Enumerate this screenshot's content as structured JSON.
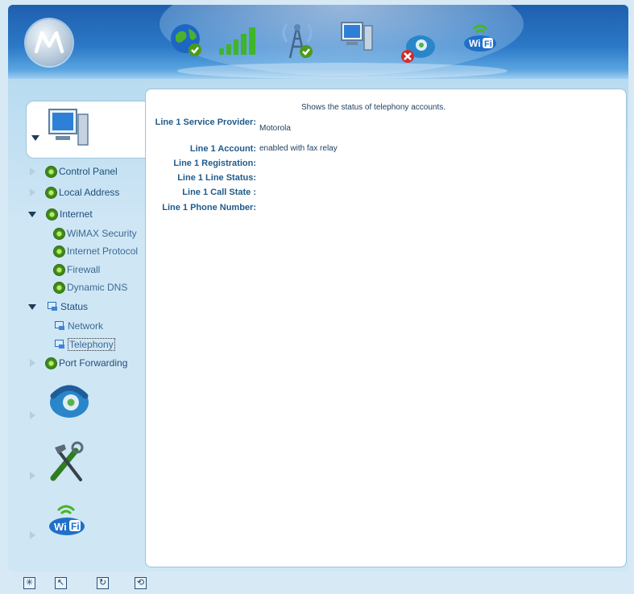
{
  "header": {
    "icons": [
      "motorola-logo",
      "globe-check-icon",
      "signal-bars-icon",
      "tower-check-icon",
      "computer-icon",
      "phone-error-icon",
      "wifi-icon"
    ]
  },
  "nav": {
    "items": [
      {
        "label": "Control Panel"
      },
      {
        "label": "Local Address"
      },
      {
        "label": "Internet"
      },
      {
        "label": "WiMAX Security"
      },
      {
        "label": "Internet Protocol"
      },
      {
        "label": "Firewall"
      },
      {
        "label": "Dynamic DNS"
      },
      {
        "label": "Status"
      },
      {
        "label": "Network"
      },
      {
        "label": "Telephony"
      },
      {
        "label": "Port Forwarding"
      }
    ]
  },
  "content": {
    "description": "Shows the status of telephony accounts.",
    "rows": [
      {
        "label": "Line 1 Service Provider:",
        "value": "Motorola"
      },
      {
        "label": "Line 1 Account:",
        "value": "enabled with fax relay"
      },
      {
        "label": "Line 1 Registration:",
        "value": ""
      },
      {
        "label": "Line 1 Line Status:",
        "value": ""
      },
      {
        "label": "Line 1 Call State :",
        "value": ""
      },
      {
        "label": "Line 1 Phone Number:",
        "value": ""
      }
    ]
  },
  "colors": {
    "header_blue": "#2c79c7",
    "panel_bg": "#cfe6f5",
    "label_blue": "#1f5b8c"
  }
}
